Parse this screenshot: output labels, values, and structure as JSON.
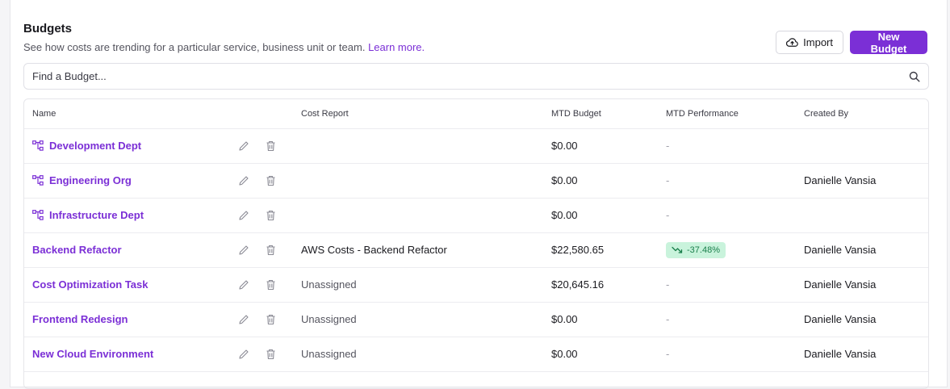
{
  "header": {
    "title": "Budgets",
    "subtitle": "See how costs are trending for a particular service, business unit or team.",
    "learn_more": "Learn more."
  },
  "actions": {
    "import_label": "Import",
    "new_budget_label": "New Budget"
  },
  "search": {
    "placeholder": "Find a Budget..."
  },
  "columns": {
    "name": "Name",
    "cost_report": "Cost Report",
    "mtd_budget": "MTD Budget",
    "mtd_performance": "MTD Performance",
    "created_by": "Created By"
  },
  "rows": [
    {
      "name": "Development Dept",
      "is_org": true,
      "cost_report": "",
      "mtd_budget": "$0.00",
      "mtd_performance": "-",
      "created_by": ""
    },
    {
      "name": "Engineering Org",
      "is_org": true,
      "cost_report": "",
      "mtd_budget": "$0.00",
      "mtd_performance": "-",
      "created_by": "Danielle Vansia"
    },
    {
      "name": "Infrastructure Dept",
      "is_org": true,
      "cost_report": "",
      "mtd_budget": "$0.00",
      "mtd_performance": "-",
      "created_by": ""
    },
    {
      "name": "Backend Refactor",
      "is_org": false,
      "cost_report": "AWS Costs - Backend Refactor",
      "mtd_budget": "$22,580.65",
      "mtd_performance": "-37.48%",
      "perf_badge": true,
      "created_by": "Danielle Vansia"
    },
    {
      "name": "Cost Optimization Task",
      "is_org": false,
      "cost_report": "Unassigned",
      "mtd_budget": "$20,645.16",
      "mtd_performance": "-",
      "created_by": "Danielle Vansia"
    },
    {
      "name": "Frontend Redesign",
      "is_org": false,
      "cost_report": "Unassigned",
      "mtd_budget": "$0.00",
      "mtd_performance": "-",
      "created_by": "Danielle Vansia"
    },
    {
      "name": "New Cloud Environment",
      "is_org": false,
      "cost_report": "Unassigned",
      "mtd_budget": "$0.00",
      "mtd_performance": "-",
      "created_by": "Danielle Vansia"
    }
  ],
  "colors": {
    "accent": "#7b2fd6",
    "badge_bg": "#c9f3dc",
    "badge_text": "#1a7f4b"
  }
}
